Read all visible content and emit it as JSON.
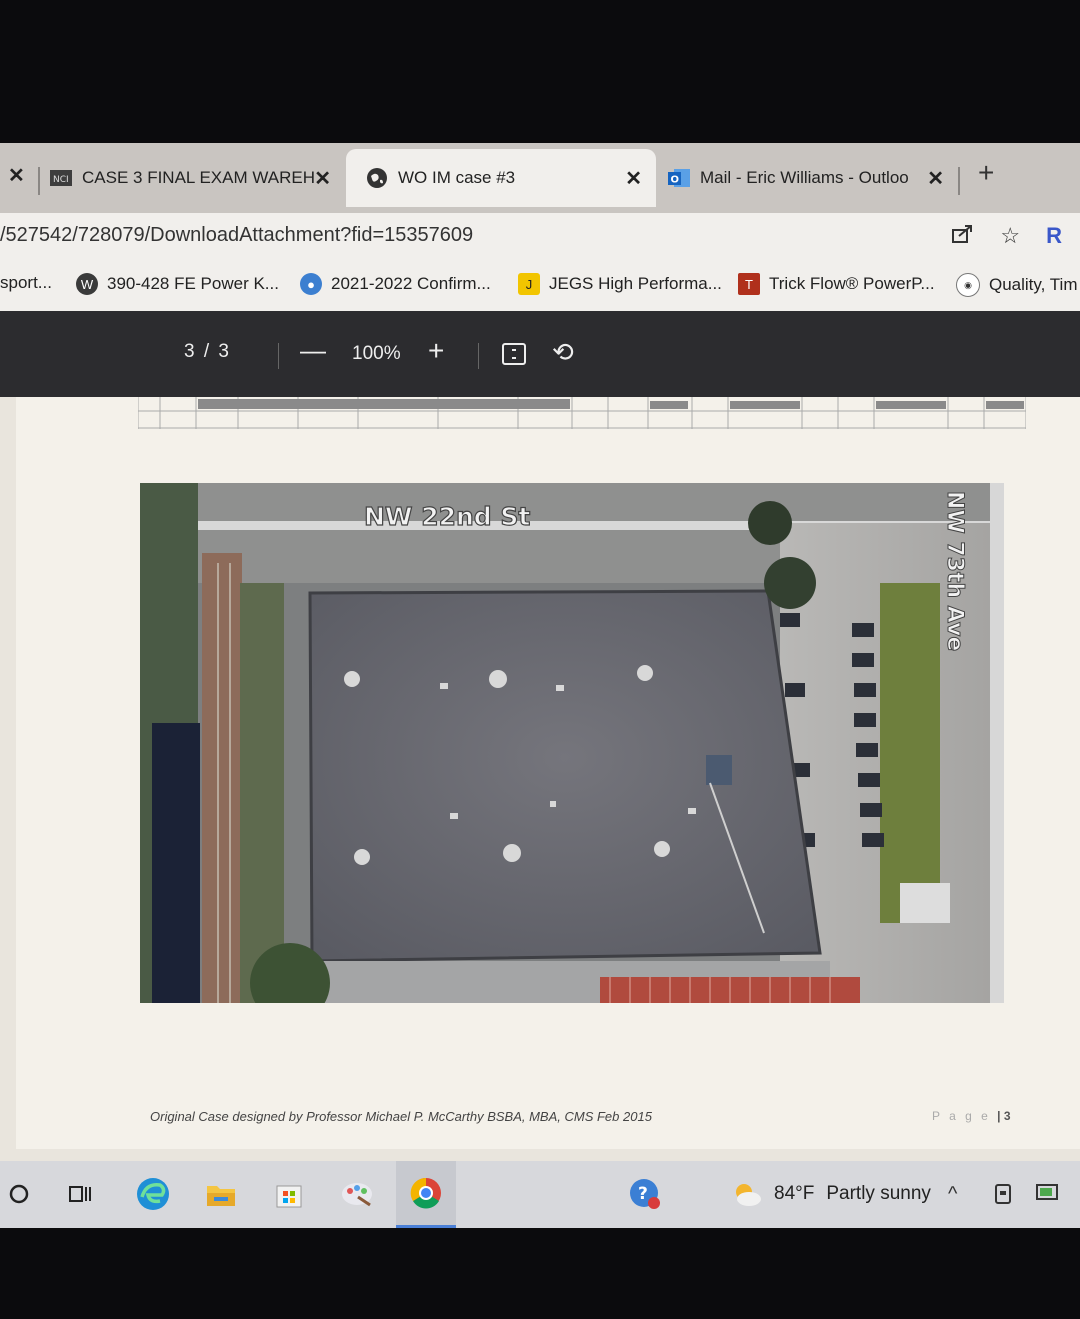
{
  "browser": {
    "tabs": [
      {
        "label": "CASE 3 FINAL EXAM WAREH",
        "icon": "document-icon",
        "active": false
      },
      {
        "label": "WO IM case #3",
        "icon": "globe-icon",
        "active": true
      },
      {
        "label": "Mail - Eric Williams - Outloo",
        "icon": "outlook-icon",
        "active": false
      }
    ],
    "url": "/527542/728079/DownloadAttachment?fid=15357609",
    "bookmarks": [
      {
        "label": "sport...",
        "icon": "none"
      },
      {
        "label": "390-428 FE Power K...",
        "icon": "wordpress-icon"
      },
      {
        "label": "2021-2022 Confirm...",
        "icon": "globe-icon"
      },
      {
        "label": "JEGS High Performa...",
        "icon": "jegs-icon"
      },
      {
        "label": "Trick Flow® PowerP...",
        "icon": "trickflow-icon"
      },
      {
        "label": "Quality, Tim",
        "icon": "site-icon"
      }
    ],
    "profile_initial": "R"
  },
  "pdf_toolbar": {
    "page_indicator": "3 / 3",
    "zoom": "100%"
  },
  "document": {
    "map_labels": {
      "street_top": "NW 22nd St",
      "street_side": "NW 73th Ave"
    },
    "footer_left": "Original Case designed by Professor Michael P. McCarthy BSBA, MBA, CMS Feb 2015",
    "footer_page_word": "P a g e",
    "footer_page_number": "| 3"
  },
  "taskbar": {
    "weather_temp": "84°F",
    "weather_desc": "Partly sunny",
    "icons": [
      "search-circle-icon",
      "task-view-icon",
      "edge-icon",
      "file-explorer-icon",
      "store-icon",
      "paint-icon",
      "chrome-icon",
      "help-icon"
    ]
  },
  "colors": {
    "pdf_toolbar_bg": "#2c2c2f",
    "taskbar_bg": "#d7d8dc",
    "tab_active_bg": "#f1efec"
  }
}
